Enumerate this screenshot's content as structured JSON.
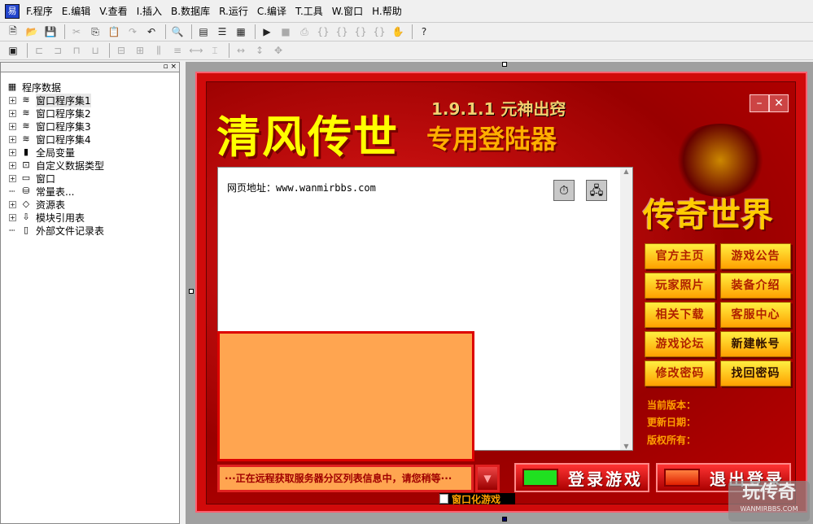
{
  "menu": [
    "F.程序",
    "E.编辑",
    "V.查看",
    "I.插入",
    "B.数据库",
    "R.运行",
    "C.编译",
    "T.工具",
    "W.窗口",
    "H.帮助"
  ],
  "toolbar1": [
    {
      "icon": "new-icon",
      "g": "🗎",
      "dis": false
    },
    {
      "icon": "open-icon",
      "g": "📂",
      "dis": false
    },
    {
      "icon": "save-icon",
      "g": "💾",
      "dis": false
    },
    {
      "sep": true
    },
    {
      "icon": "cut-icon",
      "g": "✂",
      "dis": true
    },
    {
      "icon": "copy-icon",
      "g": "⎘",
      "dis": false
    },
    {
      "icon": "paste-icon",
      "g": "📋",
      "dis": true
    },
    {
      "icon": "redo-icon",
      "g": "↷",
      "dis": true
    },
    {
      "icon": "undo-icon",
      "g": "↶",
      "dis": false
    },
    {
      "sep": true
    },
    {
      "icon": "find-icon",
      "g": "🔍",
      "dis": false
    },
    {
      "sep": true
    },
    {
      "icon": "layout1-icon",
      "g": "▤",
      "dis": false
    },
    {
      "icon": "layout2-icon",
      "g": "☰",
      "dis": false
    },
    {
      "icon": "layout3-icon",
      "g": "▦",
      "dis": false
    },
    {
      "sep": true
    },
    {
      "icon": "run-icon",
      "g": "▶",
      "dis": false
    },
    {
      "icon": "stop-icon",
      "g": "■",
      "dis": true
    },
    {
      "icon": "debug-icon",
      "g": "⎙",
      "dis": true
    },
    {
      "icon": "step-into-icon",
      "g": "{}",
      "dis": true
    },
    {
      "icon": "step-over-icon",
      "g": "{}",
      "dis": true
    },
    {
      "icon": "step-out-icon",
      "g": "{}",
      "dis": true
    },
    {
      "icon": "run-to-cursor-icon",
      "g": "{}",
      "dis": true
    },
    {
      "icon": "hand-icon",
      "g": "✋",
      "dis": true
    },
    {
      "sep": true
    },
    {
      "icon": "help-binoculars-icon",
      "g": "?",
      "dis": false
    }
  ],
  "toolbar2": [
    {
      "icon": "form-icon",
      "g": "▣",
      "dis": false
    },
    {
      "sep": true
    },
    {
      "icon": "align-left-icon",
      "g": "⊏",
      "dis": true
    },
    {
      "icon": "align-right-icon",
      "g": "⊐",
      "dis": true
    },
    {
      "icon": "align-top-icon",
      "g": "⊓",
      "dis": true
    },
    {
      "icon": "align-bottom-icon",
      "g": "⊔",
      "dis": true
    },
    {
      "sep": true
    },
    {
      "icon": "center-h-icon",
      "g": "⊟",
      "dis": true
    },
    {
      "icon": "center-v-icon",
      "g": "⊞",
      "dis": true
    },
    {
      "icon": "space-h-icon",
      "g": "⫼",
      "dis": true
    },
    {
      "icon": "space-v-icon",
      "g": "≡",
      "dis": true
    },
    {
      "icon": "equal-h-icon",
      "g": "⟷",
      "dis": true
    },
    {
      "icon": "equal-v-icon",
      "g": "⌶",
      "dis": true
    },
    {
      "sep": true
    },
    {
      "icon": "same-width-icon",
      "g": "↔",
      "dis": true
    },
    {
      "icon": "same-height-icon",
      "g": "↕",
      "dis": true
    },
    {
      "icon": "same-size-icon",
      "g": "✥",
      "dis": true
    }
  ],
  "tree": {
    "root": "程序数据",
    "items": [
      {
        "label": "窗口程序集1",
        "icon": "module-icon",
        "g": "≋",
        "exp": true,
        "sel": true
      },
      {
        "label": "窗口程序集2",
        "icon": "module-icon",
        "g": "≋",
        "exp": true
      },
      {
        "label": "窗口程序集3",
        "icon": "module-icon",
        "g": "≋",
        "exp": true
      },
      {
        "label": "窗口程序集4",
        "icon": "module-icon",
        "g": "≋",
        "exp": true
      },
      {
        "label": "全局变量",
        "icon": "global-var-icon",
        "g": "▮",
        "exp": true
      },
      {
        "label": "自定义数据类型",
        "icon": "data-type-icon",
        "g": "⊡",
        "exp": true
      },
      {
        "label": "窗口",
        "icon": "window-icon",
        "g": "▭",
        "exp": true
      },
      {
        "label": "常量表...",
        "icon": "constant-icon",
        "g": "⛁",
        "exp": false
      },
      {
        "label": "资源表",
        "icon": "resource-icon",
        "g": "◇",
        "exp": true
      },
      {
        "label": "模块引用表",
        "icon": "module-ref-icon",
        "g": "⇩",
        "exp": true
      },
      {
        "label": "外部文件记录表",
        "icon": "file-record-icon",
        "g": "▯",
        "exp": false
      }
    ]
  },
  "form": {
    "title": "清风传世",
    "version": "1.9.1.1 元神出窍",
    "subtitle": "专用登陆器",
    "logo": "传奇世界",
    "url_label": "网页地址：www.wanmirbbs.com",
    "nav_buttons": [
      "官方主页",
      "游戏公告",
      "玩家照片",
      "装备介绍",
      "相关下载",
      "客服中心",
      "游戏论坛",
      "新建帐号",
      "修改密码",
      "找回密码"
    ],
    "info": [
      "当前版本：",
      "更新日期：",
      "版权所有："
    ],
    "status": "···正在远程获取服务器分区列表信息中，请您稍等···",
    "login": "登录游戏",
    "logout": "退出登录",
    "windowed": "窗口化游戏",
    "colors": {
      "login_light": "#20e020",
      "logout_light": "#ff5020",
      "button_gold": "#ffcc00"
    }
  },
  "watermark": {
    "name": "玩传奇",
    "site": "WANMIRBBS.COM"
  }
}
